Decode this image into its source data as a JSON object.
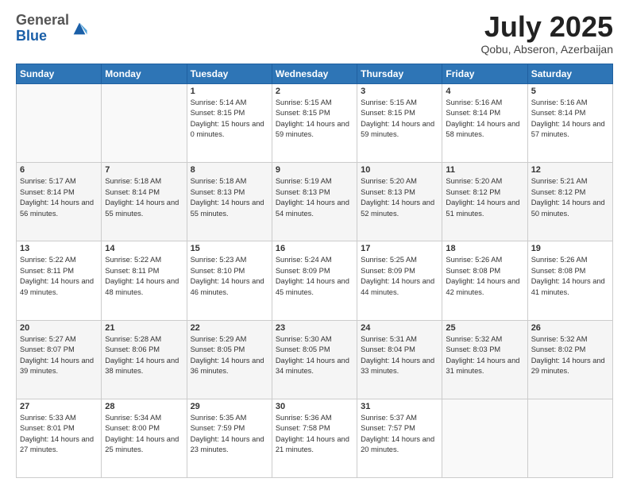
{
  "header": {
    "logo_general": "General",
    "logo_blue": "Blue",
    "month_title": "July 2025",
    "location": "Qobu, Abseron, Azerbaijan"
  },
  "weekdays": [
    "Sunday",
    "Monday",
    "Tuesday",
    "Wednesday",
    "Thursday",
    "Friday",
    "Saturday"
  ],
  "weeks": [
    [
      {
        "day": "",
        "sunrise": "",
        "sunset": "",
        "daylight": ""
      },
      {
        "day": "",
        "sunrise": "",
        "sunset": "",
        "daylight": ""
      },
      {
        "day": "1",
        "sunrise": "Sunrise: 5:14 AM",
        "sunset": "Sunset: 8:15 PM",
        "daylight": "Daylight: 15 hours and 0 minutes."
      },
      {
        "day": "2",
        "sunrise": "Sunrise: 5:15 AM",
        "sunset": "Sunset: 8:15 PM",
        "daylight": "Daylight: 14 hours and 59 minutes."
      },
      {
        "day": "3",
        "sunrise": "Sunrise: 5:15 AM",
        "sunset": "Sunset: 8:15 PM",
        "daylight": "Daylight: 14 hours and 59 minutes."
      },
      {
        "day": "4",
        "sunrise": "Sunrise: 5:16 AM",
        "sunset": "Sunset: 8:14 PM",
        "daylight": "Daylight: 14 hours and 58 minutes."
      },
      {
        "day": "5",
        "sunrise": "Sunrise: 5:16 AM",
        "sunset": "Sunset: 8:14 PM",
        "daylight": "Daylight: 14 hours and 57 minutes."
      }
    ],
    [
      {
        "day": "6",
        "sunrise": "Sunrise: 5:17 AM",
        "sunset": "Sunset: 8:14 PM",
        "daylight": "Daylight: 14 hours and 56 minutes."
      },
      {
        "day": "7",
        "sunrise": "Sunrise: 5:18 AM",
        "sunset": "Sunset: 8:14 PM",
        "daylight": "Daylight: 14 hours and 55 minutes."
      },
      {
        "day": "8",
        "sunrise": "Sunrise: 5:18 AM",
        "sunset": "Sunset: 8:13 PM",
        "daylight": "Daylight: 14 hours and 55 minutes."
      },
      {
        "day": "9",
        "sunrise": "Sunrise: 5:19 AM",
        "sunset": "Sunset: 8:13 PM",
        "daylight": "Daylight: 14 hours and 54 minutes."
      },
      {
        "day": "10",
        "sunrise": "Sunrise: 5:20 AM",
        "sunset": "Sunset: 8:13 PM",
        "daylight": "Daylight: 14 hours and 52 minutes."
      },
      {
        "day": "11",
        "sunrise": "Sunrise: 5:20 AM",
        "sunset": "Sunset: 8:12 PM",
        "daylight": "Daylight: 14 hours and 51 minutes."
      },
      {
        "day": "12",
        "sunrise": "Sunrise: 5:21 AM",
        "sunset": "Sunset: 8:12 PM",
        "daylight": "Daylight: 14 hours and 50 minutes."
      }
    ],
    [
      {
        "day": "13",
        "sunrise": "Sunrise: 5:22 AM",
        "sunset": "Sunset: 8:11 PM",
        "daylight": "Daylight: 14 hours and 49 minutes."
      },
      {
        "day": "14",
        "sunrise": "Sunrise: 5:22 AM",
        "sunset": "Sunset: 8:11 PM",
        "daylight": "Daylight: 14 hours and 48 minutes."
      },
      {
        "day": "15",
        "sunrise": "Sunrise: 5:23 AM",
        "sunset": "Sunset: 8:10 PM",
        "daylight": "Daylight: 14 hours and 46 minutes."
      },
      {
        "day": "16",
        "sunrise": "Sunrise: 5:24 AM",
        "sunset": "Sunset: 8:09 PM",
        "daylight": "Daylight: 14 hours and 45 minutes."
      },
      {
        "day": "17",
        "sunrise": "Sunrise: 5:25 AM",
        "sunset": "Sunset: 8:09 PM",
        "daylight": "Daylight: 14 hours and 44 minutes."
      },
      {
        "day": "18",
        "sunrise": "Sunrise: 5:26 AM",
        "sunset": "Sunset: 8:08 PM",
        "daylight": "Daylight: 14 hours and 42 minutes."
      },
      {
        "day": "19",
        "sunrise": "Sunrise: 5:26 AM",
        "sunset": "Sunset: 8:08 PM",
        "daylight": "Daylight: 14 hours and 41 minutes."
      }
    ],
    [
      {
        "day": "20",
        "sunrise": "Sunrise: 5:27 AM",
        "sunset": "Sunset: 8:07 PM",
        "daylight": "Daylight: 14 hours and 39 minutes."
      },
      {
        "day": "21",
        "sunrise": "Sunrise: 5:28 AM",
        "sunset": "Sunset: 8:06 PM",
        "daylight": "Daylight: 14 hours and 38 minutes."
      },
      {
        "day": "22",
        "sunrise": "Sunrise: 5:29 AM",
        "sunset": "Sunset: 8:05 PM",
        "daylight": "Daylight: 14 hours and 36 minutes."
      },
      {
        "day": "23",
        "sunrise": "Sunrise: 5:30 AM",
        "sunset": "Sunset: 8:05 PM",
        "daylight": "Daylight: 14 hours and 34 minutes."
      },
      {
        "day": "24",
        "sunrise": "Sunrise: 5:31 AM",
        "sunset": "Sunset: 8:04 PM",
        "daylight": "Daylight: 14 hours and 33 minutes."
      },
      {
        "day": "25",
        "sunrise": "Sunrise: 5:32 AM",
        "sunset": "Sunset: 8:03 PM",
        "daylight": "Daylight: 14 hours and 31 minutes."
      },
      {
        "day": "26",
        "sunrise": "Sunrise: 5:32 AM",
        "sunset": "Sunset: 8:02 PM",
        "daylight": "Daylight: 14 hours and 29 minutes."
      }
    ],
    [
      {
        "day": "27",
        "sunrise": "Sunrise: 5:33 AM",
        "sunset": "Sunset: 8:01 PM",
        "daylight": "Daylight: 14 hours and 27 minutes."
      },
      {
        "day": "28",
        "sunrise": "Sunrise: 5:34 AM",
        "sunset": "Sunset: 8:00 PM",
        "daylight": "Daylight: 14 hours and 25 minutes."
      },
      {
        "day": "29",
        "sunrise": "Sunrise: 5:35 AM",
        "sunset": "Sunset: 7:59 PM",
        "daylight": "Daylight: 14 hours and 23 minutes."
      },
      {
        "day": "30",
        "sunrise": "Sunrise: 5:36 AM",
        "sunset": "Sunset: 7:58 PM",
        "daylight": "Daylight: 14 hours and 21 minutes."
      },
      {
        "day": "31",
        "sunrise": "Sunrise: 5:37 AM",
        "sunset": "Sunset: 7:57 PM",
        "daylight": "Daylight: 14 hours and 20 minutes."
      },
      {
        "day": "",
        "sunrise": "",
        "sunset": "",
        "daylight": ""
      },
      {
        "day": "",
        "sunrise": "",
        "sunset": "",
        "daylight": ""
      }
    ]
  ]
}
